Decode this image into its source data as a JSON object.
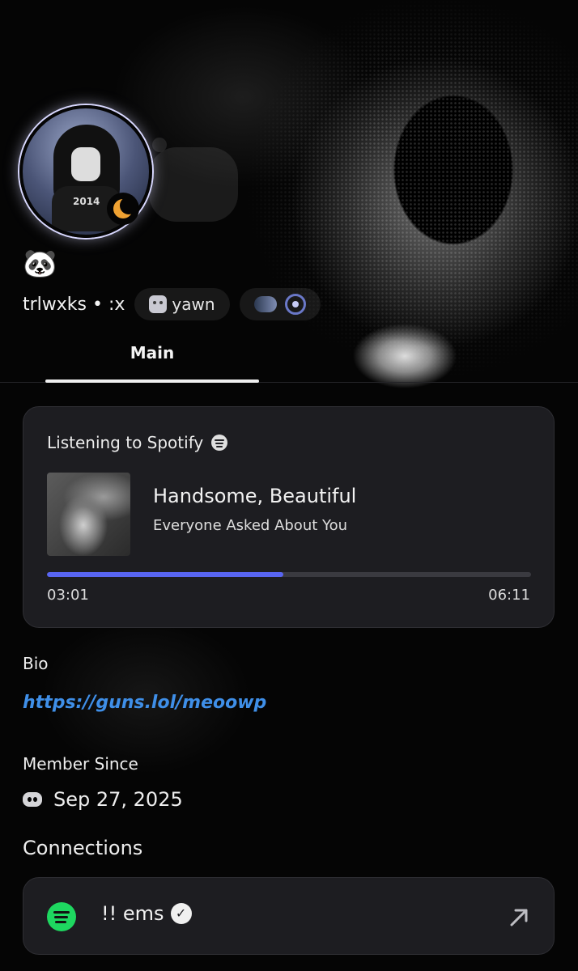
{
  "profile": {
    "emoji": "🐼",
    "username": "trlwxks",
    "separator": "•",
    "pronouns": ":x",
    "avatar_text": "2014",
    "status_icon": "moon-icon",
    "status_color": "#f0a232",
    "tag": {
      "label": "yawn",
      "icon": "cat-icon"
    },
    "badges": [
      "speed-badge-icon",
      "laurel-badge-icon"
    ]
  },
  "tabs": [
    {
      "label": "Main",
      "active": true
    }
  ],
  "activity": {
    "heading": "Listening to Spotify",
    "track_title": "Handsome, Beautiful",
    "track_artist": "Everyone Asked About You",
    "elapsed": "03:01",
    "duration": "06:11",
    "progress": 0.488,
    "accent_color": "#5865f2"
  },
  "bio": {
    "label": "Bio",
    "link": "https://guns.lol/meoowp"
  },
  "member_since": {
    "label": "Member Since",
    "date": "Sep 27, 2025",
    "icon": "discord-icon"
  },
  "connections": {
    "heading": "Connections",
    "items": [
      {
        "service": "spotify",
        "name": "!! ems",
        "verified": true,
        "brand_color": "#1ed760",
        "action_icon": "external-link-icon"
      }
    ]
  }
}
